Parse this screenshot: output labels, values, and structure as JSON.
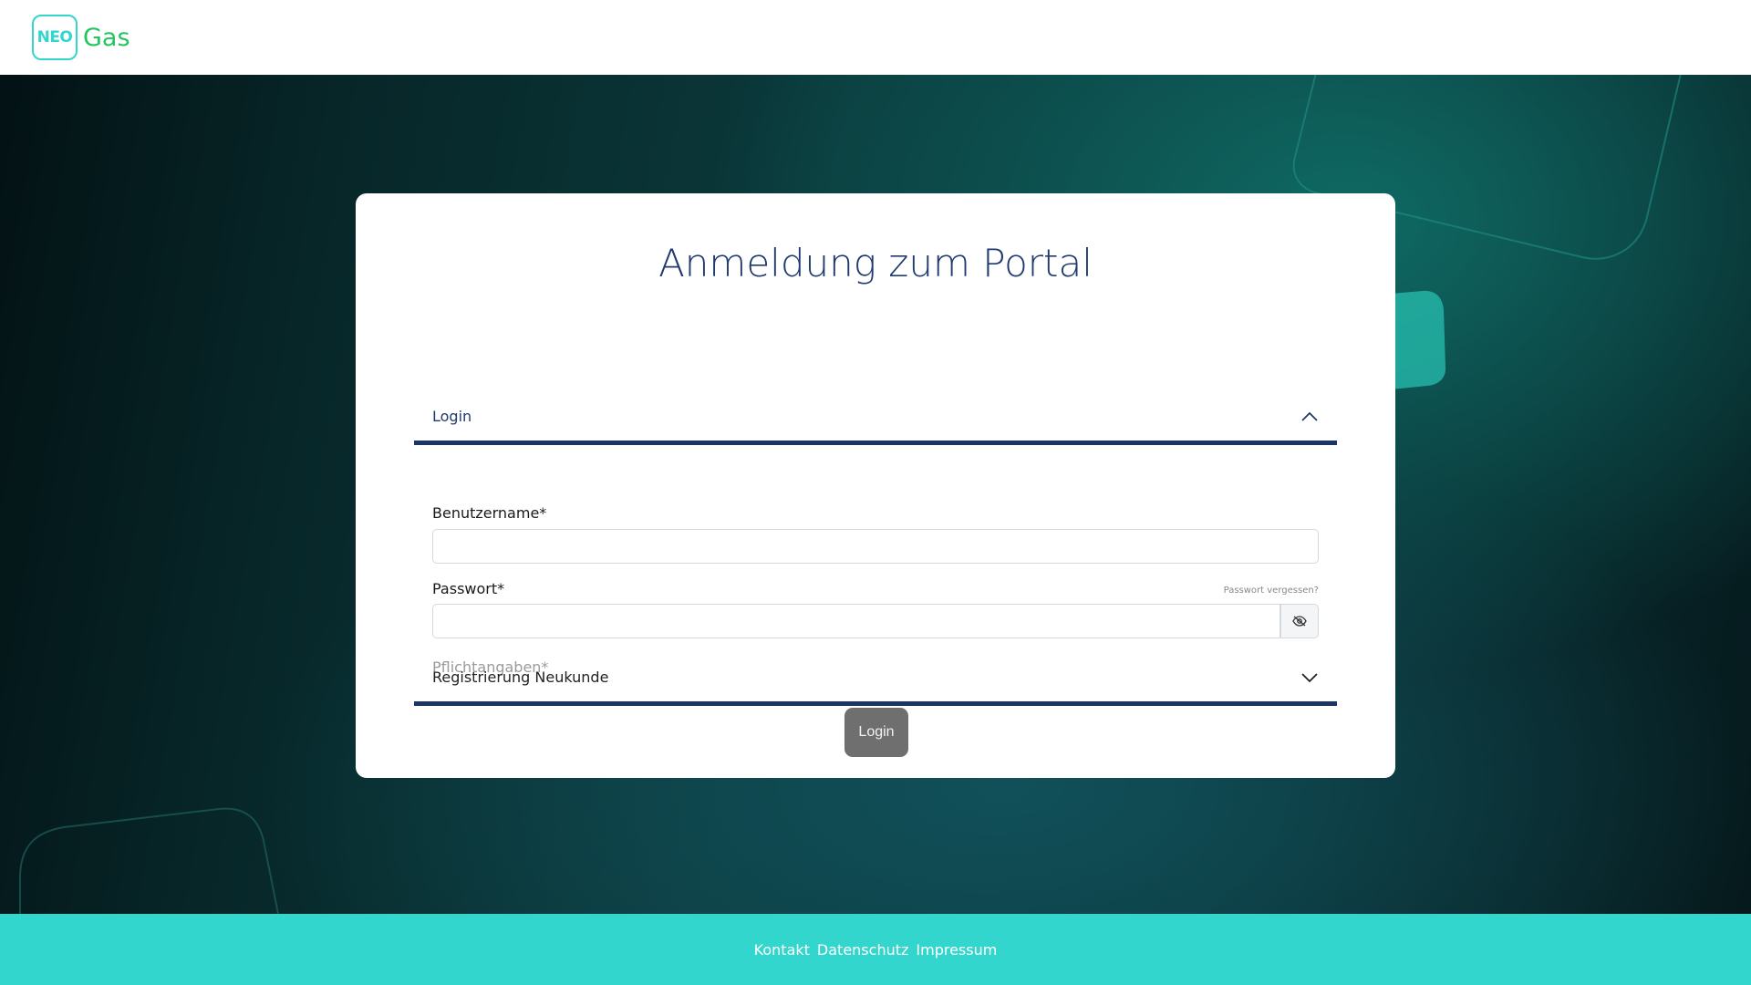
{
  "brand": {
    "logo_mark": "NEO",
    "logo_text": "Gas"
  },
  "card": {
    "title": "Anmeldung zum Portal",
    "login_section": {
      "header": "Login",
      "username_label": "Benutzername*",
      "username_value": "",
      "password_label": "Passwort*",
      "password_value": "",
      "forgot_link": "Passwort vergessen?",
      "required_note": "Pflichtangaben*",
      "submit_label": "Login"
    },
    "register_section": {
      "header": "Registrierung Neukunde"
    }
  },
  "footer": {
    "links": [
      "Kontakt",
      "Datenschutz",
      "Impressum"
    ]
  },
  "icons": {
    "password_toggle": "eye-off-icon",
    "login_chevron": "chevron-up-icon",
    "register_chevron": "chevron-down-icon"
  },
  "colors": {
    "accent": "#33d6cc",
    "logo_green": "#22c55e",
    "primary_navy": "#1b3568",
    "button_gray": "#6f6f6f"
  }
}
